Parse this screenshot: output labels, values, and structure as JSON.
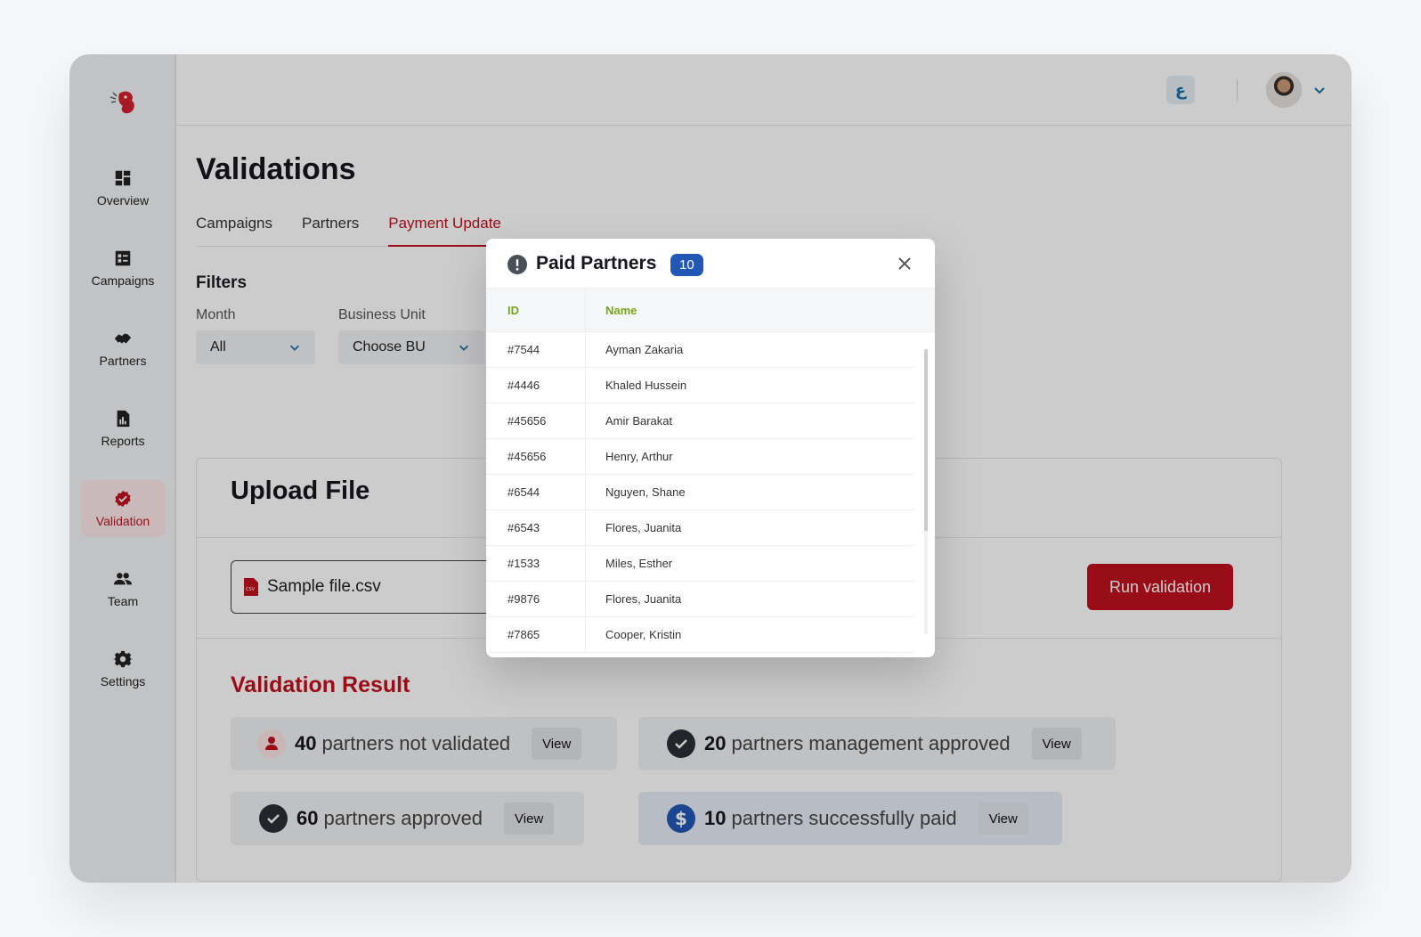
{
  "sidebar": {
    "items": [
      {
        "label": "Overview",
        "icon": "dashboard-icon",
        "active": false
      },
      {
        "label": "Campaigns",
        "icon": "campaign-list-icon",
        "active": false
      },
      {
        "label": "Partners",
        "icon": "handshake-icon",
        "active": false
      },
      {
        "label": "Reports",
        "icon": "report-file-icon",
        "active": false
      },
      {
        "label": "Validation",
        "icon": "check-badge-icon",
        "active": true
      },
      {
        "label": "Team",
        "icon": "team-icon",
        "active": false
      },
      {
        "label": "Settings",
        "icon": "gear-icon",
        "active": false
      }
    ]
  },
  "header": {
    "lang_label": "ع"
  },
  "page": {
    "title": "Validations",
    "tabs": [
      {
        "label": "Campaigns",
        "active": false
      },
      {
        "label": "Partners",
        "active": false
      },
      {
        "label": "Payment Update",
        "active": true
      }
    ]
  },
  "filters": {
    "title": "Filters",
    "month": {
      "label": "Month",
      "value": "All"
    },
    "business_unit": {
      "label": "Business Unit",
      "value": "Choose BU"
    }
  },
  "upload": {
    "title": "Upload File",
    "file_name": "Sample file.csv",
    "run_label": "Run validation"
  },
  "result": {
    "title": "Validation Result",
    "stats": [
      {
        "count": "40",
        "text": "partners not validated",
        "view": "View",
        "icon": "user-icon"
      },
      {
        "count": "20",
        "text": "partners management approved",
        "view": "View",
        "icon": "check-circle-icon"
      },
      {
        "count": "60",
        "text": "partners approved",
        "view": "View",
        "icon": "check-circle-icon"
      },
      {
        "count": "10",
        "text": "partners successfully paid",
        "view": "View",
        "icon": "dollar-icon"
      }
    ]
  },
  "modal": {
    "title": "Paid Partners",
    "badge": "10",
    "columns": {
      "id": "ID",
      "name": "Name"
    },
    "rows": [
      {
        "id": "#7544",
        "name": "Ayman Zakaria"
      },
      {
        "id": "#4446",
        "name": "Khaled Hussein"
      },
      {
        "id": "#45656",
        "name": "Amir Barakat"
      },
      {
        "id": "#45656",
        "name": "Henry, Arthur"
      },
      {
        "id": "#6544",
        "name": "Nguyen, Shane"
      },
      {
        "id": "#6543",
        "name": "Flores, Juanita"
      },
      {
        "id": "#1533",
        "name": "Miles, Esther"
      },
      {
        "id": "#9876",
        "name": "Flores, Juanita"
      },
      {
        "id": "#7865",
        "name": "Cooper, Kristin"
      }
    ]
  },
  "colors": {
    "brand": "#c0111f",
    "badge": "#2257b6",
    "table_header_text": "#7aa31a"
  }
}
